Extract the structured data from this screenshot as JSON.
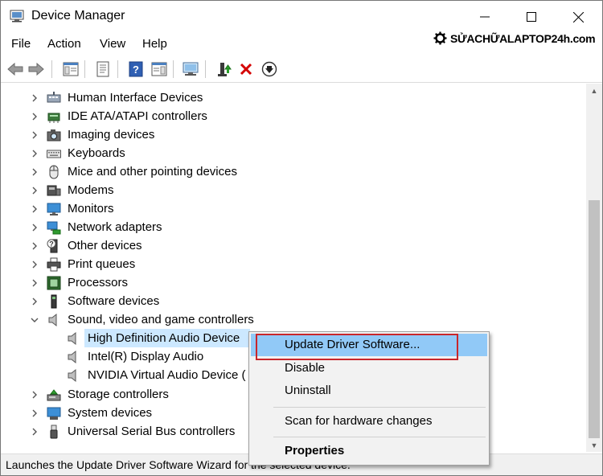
{
  "window": {
    "title": "Device Manager",
    "controls": {
      "minimize": "—",
      "maximize": "☐",
      "close": "✕"
    }
  },
  "menu": [
    "File",
    "Action",
    "View",
    "Help"
  ],
  "brand": {
    "text": "SỬACHỮALAPTOP24h.com"
  },
  "toolbar": {
    "buttons": [
      "back-icon",
      "forward-icon",
      "show-hide-console-tree-icon",
      "properties-icon",
      "help-icon",
      "action-pane-icon",
      "scan-hardware-icon",
      "update-driver-icon",
      "uninstall-device-icon",
      "disable-device-icon"
    ]
  },
  "tree": {
    "categories": [
      {
        "label": "Human Interface Devices",
        "icon": "hid-icon"
      },
      {
        "label": "IDE ATA/ATAPI controllers",
        "icon": "ide-controller-icon"
      },
      {
        "label": "Imaging devices",
        "icon": "camera-icon"
      },
      {
        "label": "Keyboards",
        "icon": "keyboard-icon"
      },
      {
        "label": "Mice and other pointing devices",
        "icon": "mouse-icon"
      },
      {
        "label": "Modems",
        "icon": "modem-icon"
      },
      {
        "label": "Monitors",
        "icon": "monitor-icon"
      },
      {
        "label": "Network adapters",
        "icon": "network-icon"
      },
      {
        "label": "Other devices",
        "icon": "unknown-device-icon"
      },
      {
        "label": "Print queues",
        "icon": "printer-icon"
      },
      {
        "label": "Processors",
        "icon": "processor-icon"
      },
      {
        "label": "Software devices",
        "icon": "software-device-icon"
      },
      {
        "label": "Sound, video and game controllers",
        "icon": "speaker-icon",
        "expanded": true
      }
    ],
    "sound_children": [
      {
        "label": "High Definition Audio Device",
        "selected": true
      },
      {
        "label": "Intel(R) Display Audio"
      },
      {
        "label": "NVIDIA Virtual Audio Device ("
      }
    ],
    "after": [
      {
        "label": "Storage controllers",
        "icon": "storage-icon"
      },
      {
        "label": "System devices",
        "icon": "system-device-icon"
      },
      {
        "label": "Universal Serial Bus controllers",
        "icon": "usb-icon"
      }
    ]
  },
  "context_menu": {
    "items": [
      {
        "label": "Update Driver Software...",
        "highlighted": true
      },
      {
        "label": "Disable"
      },
      {
        "label": "Uninstall"
      },
      {
        "label": "Scan for hardware changes"
      },
      {
        "label": "Properties",
        "bold": true
      }
    ]
  },
  "status": {
    "text": "Launches the Update Driver Software Wizard for the selected device."
  },
  "colors": {
    "selection": "#cce8ff",
    "menu_highlight": "#91c9f7",
    "callout": "#c8262b",
    "uninstall_x": "#d40000"
  }
}
